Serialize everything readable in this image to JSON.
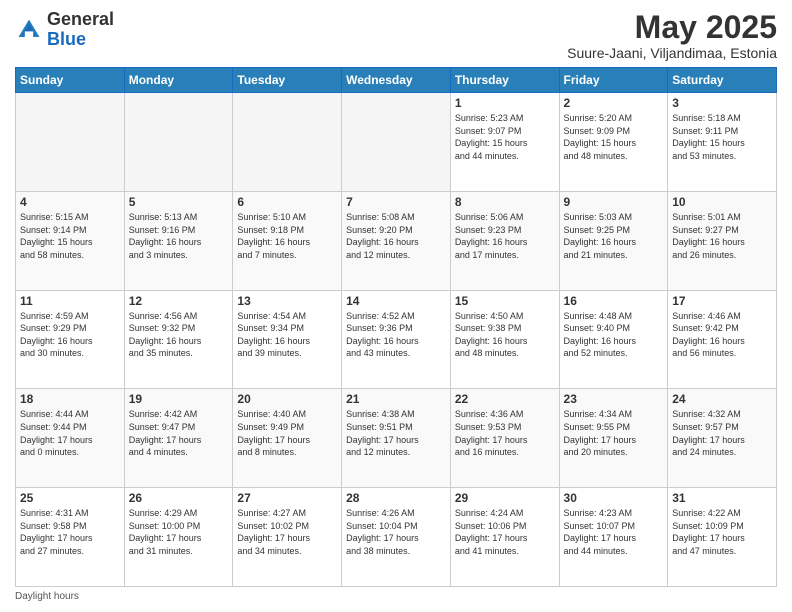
{
  "header": {
    "logo_general": "General",
    "logo_blue": "Blue",
    "month_title": "May 2025",
    "subtitle": "Suure-Jaani, Viljandimaa, Estonia"
  },
  "days_of_week": [
    "Sunday",
    "Monday",
    "Tuesday",
    "Wednesday",
    "Thursday",
    "Friday",
    "Saturday"
  ],
  "weeks": [
    [
      {
        "day": "",
        "info": ""
      },
      {
        "day": "",
        "info": ""
      },
      {
        "day": "",
        "info": ""
      },
      {
        "day": "",
        "info": ""
      },
      {
        "day": "1",
        "info": "Sunrise: 5:23 AM\nSunset: 9:07 PM\nDaylight: 15 hours\nand 44 minutes."
      },
      {
        "day": "2",
        "info": "Sunrise: 5:20 AM\nSunset: 9:09 PM\nDaylight: 15 hours\nand 48 minutes."
      },
      {
        "day": "3",
        "info": "Sunrise: 5:18 AM\nSunset: 9:11 PM\nDaylight: 15 hours\nand 53 minutes."
      }
    ],
    [
      {
        "day": "4",
        "info": "Sunrise: 5:15 AM\nSunset: 9:14 PM\nDaylight: 15 hours\nand 58 minutes."
      },
      {
        "day": "5",
        "info": "Sunrise: 5:13 AM\nSunset: 9:16 PM\nDaylight: 16 hours\nand 3 minutes."
      },
      {
        "day": "6",
        "info": "Sunrise: 5:10 AM\nSunset: 9:18 PM\nDaylight: 16 hours\nand 7 minutes."
      },
      {
        "day": "7",
        "info": "Sunrise: 5:08 AM\nSunset: 9:20 PM\nDaylight: 16 hours\nand 12 minutes."
      },
      {
        "day": "8",
        "info": "Sunrise: 5:06 AM\nSunset: 9:23 PM\nDaylight: 16 hours\nand 17 minutes."
      },
      {
        "day": "9",
        "info": "Sunrise: 5:03 AM\nSunset: 9:25 PM\nDaylight: 16 hours\nand 21 minutes."
      },
      {
        "day": "10",
        "info": "Sunrise: 5:01 AM\nSunset: 9:27 PM\nDaylight: 16 hours\nand 26 minutes."
      }
    ],
    [
      {
        "day": "11",
        "info": "Sunrise: 4:59 AM\nSunset: 9:29 PM\nDaylight: 16 hours\nand 30 minutes."
      },
      {
        "day": "12",
        "info": "Sunrise: 4:56 AM\nSunset: 9:32 PM\nDaylight: 16 hours\nand 35 minutes."
      },
      {
        "day": "13",
        "info": "Sunrise: 4:54 AM\nSunset: 9:34 PM\nDaylight: 16 hours\nand 39 minutes."
      },
      {
        "day": "14",
        "info": "Sunrise: 4:52 AM\nSunset: 9:36 PM\nDaylight: 16 hours\nand 43 minutes."
      },
      {
        "day": "15",
        "info": "Sunrise: 4:50 AM\nSunset: 9:38 PM\nDaylight: 16 hours\nand 48 minutes."
      },
      {
        "day": "16",
        "info": "Sunrise: 4:48 AM\nSunset: 9:40 PM\nDaylight: 16 hours\nand 52 minutes."
      },
      {
        "day": "17",
        "info": "Sunrise: 4:46 AM\nSunset: 9:42 PM\nDaylight: 16 hours\nand 56 minutes."
      }
    ],
    [
      {
        "day": "18",
        "info": "Sunrise: 4:44 AM\nSunset: 9:44 PM\nDaylight: 17 hours\nand 0 minutes."
      },
      {
        "day": "19",
        "info": "Sunrise: 4:42 AM\nSunset: 9:47 PM\nDaylight: 17 hours\nand 4 minutes."
      },
      {
        "day": "20",
        "info": "Sunrise: 4:40 AM\nSunset: 9:49 PM\nDaylight: 17 hours\nand 8 minutes."
      },
      {
        "day": "21",
        "info": "Sunrise: 4:38 AM\nSunset: 9:51 PM\nDaylight: 17 hours\nand 12 minutes."
      },
      {
        "day": "22",
        "info": "Sunrise: 4:36 AM\nSunset: 9:53 PM\nDaylight: 17 hours\nand 16 minutes."
      },
      {
        "day": "23",
        "info": "Sunrise: 4:34 AM\nSunset: 9:55 PM\nDaylight: 17 hours\nand 20 minutes."
      },
      {
        "day": "24",
        "info": "Sunrise: 4:32 AM\nSunset: 9:57 PM\nDaylight: 17 hours\nand 24 minutes."
      }
    ],
    [
      {
        "day": "25",
        "info": "Sunrise: 4:31 AM\nSunset: 9:58 PM\nDaylight: 17 hours\nand 27 minutes."
      },
      {
        "day": "26",
        "info": "Sunrise: 4:29 AM\nSunset: 10:00 PM\nDaylight: 17 hours\nand 31 minutes."
      },
      {
        "day": "27",
        "info": "Sunrise: 4:27 AM\nSunset: 10:02 PM\nDaylight: 17 hours\nand 34 minutes."
      },
      {
        "day": "28",
        "info": "Sunrise: 4:26 AM\nSunset: 10:04 PM\nDaylight: 17 hours\nand 38 minutes."
      },
      {
        "day": "29",
        "info": "Sunrise: 4:24 AM\nSunset: 10:06 PM\nDaylight: 17 hours\nand 41 minutes."
      },
      {
        "day": "30",
        "info": "Sunrise: 4:23 AM\nSunset: 10:07 PM\nDaylight: 17 hours\nand 44 minutes."
      },
      {
        "day": "31",
        "info": "Sunrise: 4:22 AM\nSunset: 10:09 PM\nDaylight: 17 hours\nand 47 minutes."
      }
    ]
  ],
  "footer": {
    "note": "Daylight hours"
  }
}
